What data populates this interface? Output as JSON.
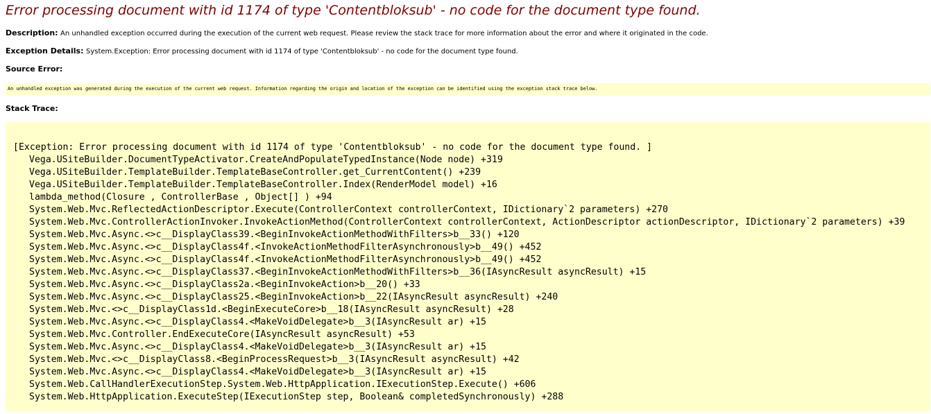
{
  "title": "Error processing document with id 1174 of type 'Contentbloksub' - no code for the document type found.",
  "description": {
    "label": "Description:",
    "text": "An unhandled exception occurred during the execution of the current web request. Please review the stack trace for more information about the error and where it originated in the code."
  },
  "exception_details": {
    "label": "Exception Details:",
    "text": "System.Exception: Error processing document with id 1174 of type 'Contentbloksub' - no code for the document type found."
  },
  "source_error": {
    "label": "Source Error:",
    "text": "An unhandled exception was generated during the execution of the current web request. Information regarding the origin and location of the exception can be identified using the exception stack trace below."
  },
  "stack_trace": {
    "label": "Stack Trace:",
    "header": "[Exception: Error processing document with id 1174 of type 'Contentbloksub' - no code for the document type found. ]",
    "lines": [
      "Vega.USiteBuilder.DocumentTypeActivator.CreateAndPopulateTypedInstance(Node node) +319",
      "Vega.USiteBuilder.TemplateBuilder.TemplateBaseController.get_CurrentContent() +239",
      "Vega.USiteBuilder.TemplateBuilder.TemplateBaseController.Index(RenderModel model) +16",
      "lambda_method(Closure , ControllerBase , Object[] ) +94",
      "System.Web.Mvc.ReflectedActionDescriptor.Execute(ControllerContext controllerContext, IDictionary`2 parameters) +270",
      "System.Web.Mvc.ControllerActionInvoker.InvokeActionMethod(ControllerContext controllerContext, ActionDescriptor actionDescriptor, IDictionary`2 parameters) +39",
      "System.Web.Mvc.Async.<>c__DisplayClass39.<BeginInvokeActionMethodWithFilters>b__33() +120",
      "System.Web.Mvc.Async.<>c__DisplayClass4f.<InvokeActionMethodFilterAsynchronously>b__49() +452",
      "System.Web.Mvc.Async.<>c__DisplayClass4f.<InvokeActionMethodFilterAsynchronously>b__49() +452",
      "System.Web.Mvc.Async.<>c__DisplayClass37.<BeginInvokeActionMethodWithFilters>b__36(IAsyncResult asyncResult) +15",
      "System.Web.Mvc.Async.<>c__DisplayClass2a.<BeginInvokeAction>b__20() +33",
      "System.Web.Mvc.Async.<>c__DisplayClass25.<BeginInvokeAction>b__22(IAsyncResult asyncResult) +240",
      "System.Web.Mvc.<>c__DisplayClass1d.<BeginExecuteCore>b__18(IAsyncResult asyncResult) +28",
      "System.Web.Mvc.Async.<>c__DisplayClass4.<MakeVoidDelegate>b__3(IAsyncResult ar) +15",
      "System.Web.Mvc.Controller.EndExecuteCore(IAsyncResult asyncResult) +53",
      "System.Web.Mvc.Async.<>c__DisplayClass4.<MakeVoidDelegate>b__3(IAsyncResult ar) +15",
      "System.Web.Mvc.<>c__DisplayClass8.<BeginProcessRequest>b__3(IAsyncResult asyncResult) +42",
      "System.Web.Mvc.Async.<>c__DisplayClass4.<MakeVoidDelegate>b__3(IAsyncResult ar) +15",
      "System.Web.CallHandlerExecutionStep.System.Web.HttpApplication.IExecutionStep.Execute() +606",
      "System.Web.HttpApplication.ExecuteStep(IExecutionStep step, Boolean& completedSynchronously) +288"
    ]
  },
  "colors": {
    "title": "#800000",
    "code_background": "#ffffcc"
  }
}
